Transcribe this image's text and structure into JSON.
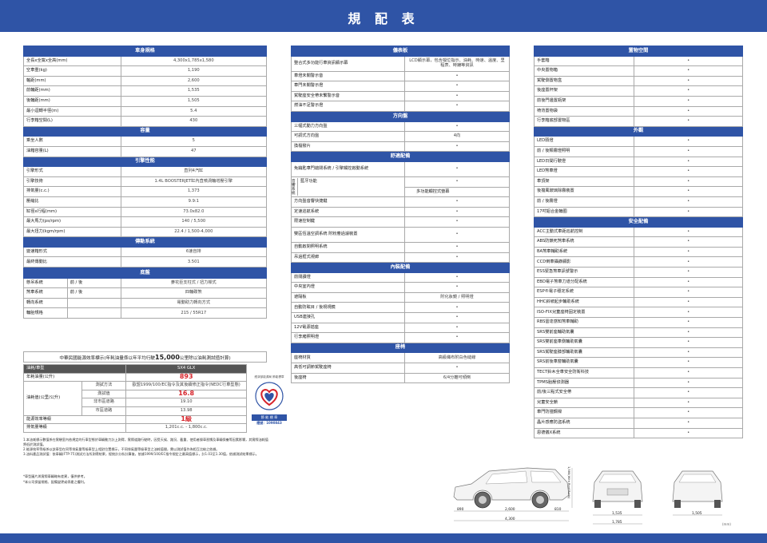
{
  "page_title": "規 配 表",
  "specs": [
    {
      "header": "車身規格",
      "rows": [
        {
          "label": "全長x全寬x全高(mm)",
          "value": "4,300x1,785x1,580"
        },
        {
          "label": "空車重(kg)",
          "value": "1,190"
        },
        {
          "label": "軸距(mm)",
          "value": "2,600"
        },
        {
          "label": "前輪距(mm)",
          "value": "1,535"
        },
        {
          "label": "後輪距(mm)",
          "value": "1,505"
        },
        {
          "label": "最小迴轉半徑(m)",
          "value": "5.4"
        },
        {
          "label": "行李箱空間(L)",
          "value": "430"
        }
      ]
    },
    {
      "header": "容量",
      "rows": [
        {
          "label": "乘坐人數",
          "value": "5"
        },
        {
          "label": "油箱容量(L)",
          "value": "47"
        }
      ]
    },
    {
      "header": "引擎性能",
      "rows": [
        {
          "label": "引擎形式",
          "value": "直列4汽缸"
        },
        {
          "label": "引擎技術",
          "value": "1.4L BOOSTERJET缸內直噴渦輪增壓引擎"
        },
        {
          "label": "排氣量(c.c.)",
          "value": "1,373"
        },
        {
          "label": "壓縮比",
          "value": "9.9:1"
        },
        {
          "label": "缸徑x行程(mm)",
          "value": "73.0x82.0"
        },
        {
          "label": "最大馬力(ps/rpm)",
          "value": "140 / 5,500"
        },
        {
          "label": "最大扭力(kgm/rpm)",
          "value": "22.4 / 1,500-4,000"
        }
      ]
    },
    {
      "header": "傳動系統",
      "rows": [
        {
          "label": "變速箱形式",
          "value": "6速自排"
        },
        {
          "label": "最終傳動比",
          "value": "3.501"
        }
      ]
    }
  ],
  "chassis": {
    "header": "底盤",
    "rows": [
      {
        "label": "懸吊系統",
        "sub": "前 / 後",
        "value": "麥花臣支柱式 / 扭力樑式"
      },
      {
        "label": "煞車系統",
        "sub": "前 / 後",
        "value": "四輪碟煞"
      },
      {
        "label": "轉向系統",
        "sub": "",
        "value": "電動助力轉向方式"
      },
      {
        "label": "輪胎規格",
        "sub": "",
        "value": "215 / 55R17"
      }
    ]
  },
  "emission": {
    "title_pre": "中華民國能源效率標示(年耗油量係以年平均行駛",
    "title_bold": "15,000",
    "title_post": "公里除以油耗測試值計算)",
    "col_head": "油耗/車型",
    "model": "SX4 GLX",
    "annual_label": "年耗油量(公升)",
    "annual_value": "893",
    "method_label": "測試方法",
    "method_value": "歐盟1999/100/EC指令及其後續修正指令(NEDC行車型態)",
    "fuel_label": "油耗值(公里/公升)",
    "test_label": "測試值",
    "test_value": "16.8",
    "urban_label": "非市區道路",
    "urban_value": "19.10",
    "city_label": "市區道路",
    "city_value": "13.98",
    "grade_label": "能源效率等級",
    "grade_value": "1級",
    "disp_label": "排氣量等級",
    "disp_value": "1,201c.c. - 1,800c.c.",
    "badge_top": "經濟部能源局 節能標章",
    "badge_text": "節 能 標 章",
    "badge_cert": "證號：1090843"
  },
  "notes": [
    "1.本油耗標示數值係在實驗室內依規定的行車型態於車輛動力計上測得，實際道路行駛時，因受天候、路況、載重、使用者操車習慣及車輛保養等因素影響，其實際油耗值將低於測試值。",
    "2.能源效率等級係以該車型在同等排氣量等級車型上相對位置標示，不同排氣量等級車型之油耗值間，需以測試值作為相互比較之依據。",
    "3.油料產品測試值：依車輛(FTP-75)測試方法所測得結果，經統計分析計算後，依據1999/100/EC指令規定之最高值標示，計1.03至1.30值，依據測試結果標示。"
  ],
  "footnotes": [
    "*車型圖片與實際車輛略有差異，僅供參考。",
    "*本公司保留規格、配備變更或停產之權利。"
  ],
  "col2": [
    {
      "header": "儀表板",
      "rows": [
        {
          "label": "整合式多功能行車資訊顯示幕",
          "value": "LCD顯示幕，包含檔位指示、油耗、時速、溫度、里程表、時鐘等資訊",
          "tall": true
        },
        {
          "label": "車燈未關警示音",
          "value": "•"
        },
        {
          "label": "車門未關警示燈",
          "value": "•"
        },
        {
          "label": "駕駛座安全帶未繫警示音",
          "value": "•"
        },
        {
          "label": "燃油不足警示燈",
          "value": "•"
        }
      ]
    },
    {
      "header": "方向盤",
      "rows": [
        {
          "label": "三幅式動力方向盤",
          "value": "•"
        },
        {
          "label": "可調式方向盤",
          "value": "4向"
        },
        {
          "label": "換檔撥片",
          "value": "•"
        }
      ]
    },
    {
      "header": "舒適配備",
      "rows": [
        {
          "label": "免鑰匙車門啟閉系統 / 引擎觸控啟動系統",
          "value": "•",
          "tall": true
        },
        {
          "label": "藍牙功能",
          "value": "•",
          "group": "音響系統"
        },
        {
          "label": "多功能觸控式螢幕",
          "value": "•",
          "group": "音響系統"
        },
        {
          "label": "方向盤音響快捷鍵",
          "value": "•"
        },
        {
          "label": "定速巡航系統",
          "value": "•"
        },
        {
          "label": "限速控制鍵",
          "value": "•"
        },
        {
          "label": "雙區恆溫空調系統 附粉塵過濾裝置",
          "value": "•",
          "tall": true
        },
        {
          "label": "自動啟閉照明系統",
          "value": "•"
        },
        {
          "label": "吊過框式視廊",
          "value": "•"
        }
      ]
    },
    {
      "header": "內裝配備",
      "rows": [
        {
          "label": "前閱讀燈",
          "value": "•"
        },
        {
          "label": "中央室內燈",
          "value": "•"
        },
        {
          "label": "遮陽板",
          "value": "附化妝鏡 / 照明燈"
        },
        {
          "label": "自動防眩目 / 後視視鏡",
          "value": "•"
        },
        {
          "label": "USB連接孔",
          "value": "•"
        },
        {
          "label": "12V電源插座",
          "value": "•"
        },
        {
          "label": "行李廂照明燈",
          "value": "•"
        }
      ]
    },
    {
      "header": "座椅",
      "rows": [
        {
          "label": "座椅材質",
          "value": "高級織布附白色縫線"
        },
        {
          "label": "高低可調節駕駛座椅",
          "value": "•"
        },
        {
          "label": "後座椅",
          "value": "6/4分離可傾倒"
        }
      ]
    }
  ],
  "col3": [
    {
      "header": "置物空間",
      "rows": [
        {
          "label": "手套箱",
          "value": "•"
        },
        {
          "label": "中央置物箱",
          "value": "•"
        },
        {
          "label": "駕駛側置物盒",
          "value": "•"
        },
        {
          "label": "後座置杯架",
          "value": "•"
        },
        {
          "label": "前後門邊置瓶架",
          "value": "•"
        },
        {
          "label": "椅背置物袋",
          "value": "•"
        },
        {
          "label": "行李箱底部置物區",
          "value": "•"
        }
      ]
    },
    {
      "header": "外觀",
      "rows": [
        {
          "label": "LED頭燈",
          "value": "•"
        },
        {
          "label": "前 / 後類霧燈照明",
          "value": "•"
        },
        {
          "label": "LED日間行駛燈",
          "value": "•"
        },
        {
          "label": "LED煞車燈",
          "value": "•"
        },
        {
          "label": "車頂架",
          "value": "•"
        },
        {
          "label": "後擋風玻璃除霧裝置",
          "value": "•"
        },
        {
          "label": "前 / 後霧燈",
          "value": "•"
        },
        {
          "label": "17吋鋁合金輪圈",
          "value": "•"
        }
      ]
    },
    {
      "header": "安全配備",
      "rows": [
        {
          "label": "ACC主動式車距巡航控制",
          "value": "•"
        },
        {
          "label": "ABS防鎖死煞車系統",
          "value": "•"
        },
        {
          "label": "BA煞車輔助系統",
          "value": "•"
        },
        {
          "label": "CCD倒車攝錄顯影",
          "value": "•"
        },
        {
          "label": "ESS緊急煞車訊號警示",
          "value": "•"
        },
        {
          "label": "EBD電子煞車力道分配系統",
          "value": "•"
        },
        {
          "label": "ESP®電子穩定系統",
          "value": "•"
        },
        {
          "label": "HHC斜坡起步輔助系統",
          "value": "•"
        },
        {
          "label": "ISO-FIX兒童座椅固定裝置",
          "value": "•"
        },
        {
          "label": "RBS雷達感知煞車輔助",
          "value": "•"
        },
        {
          "label": "SRS雙前座輔助氣囊",
          "value": "•"
        },
        {
          "label": "SRS雙前座車側輔助氣囊",
          "value": "•"
        },
        {
          "label": "SRS駕駛座膝部輔助氣囊",
          "value": "•"
        },
        {
          "label": "SRS前後車窗輔助氣囊",
          "value": "•"
        },
        {
          "label": "TECT鈴木全車安全防衛科技",
          "value": "•"
        },
        {
          "label": "TPMS胎壓偵測器",
          "value": "•"
        },
        {
          "label": "前/後三點式安全帶",
          "value": "•"
        },
        {
          "label": "兒童安全鎖",
          "value": "•"
        },
        {
          "label": "車門防撞鋼樑",
          "value": "•"
        },
        {
          "label": "晶片感應防盜系統",
          "value": "•"
        },
        {
          "label": "恩德儀X系統",
          "value": "•"
        }
      ]
    }
  ],
  "dims": {
    "front_overhang": "890",
    "wheelbase": "2,600",
    "rear_overhang": "810",
    "length": "4,300",
    "front_track": "1,535",
    "width": "1,785",
    "rear_track": "1,505",
    "height_label": "1,580(With Roof Rails)",
    "unit": "(mm)"
  }
}
